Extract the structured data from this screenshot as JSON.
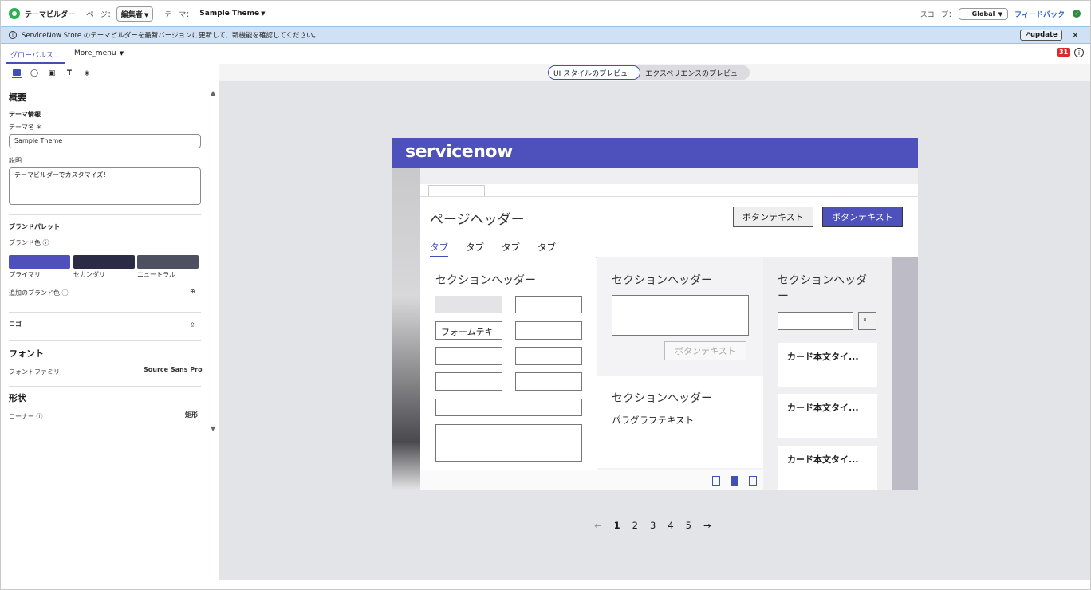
{
  "topbar": {
    "app_title": "テーマビルダー",
    "page_label": "ページ：",
    "page_value": "編集者",
    "theme_label": "テーマ：",
    "theme_value": "Sample Theme",
    "scope_label": "スコープ：",
    "scope_value": "Global",
    "feedback": "フィードバック"
  },
  "banner": {
    "text": "ServiceNow Store のテーマビルダーを最新バージョンに更新して、新機能を確認してください。",
    "update": "update"
  },
  "tabs": {
    "global": "グローバルス...",
    "more": "More_menu",
    "badge": "31"
  },
  "left": {
    "overview": "概要",
    "theme_info": "テーマ情報",
    "theme_name_label": "テーマ名 ✳",
    "theme_name_value": "Sample Theme",
    "desc_label": "説明",
    "desc_value": "テーマビルダーでカスタマイズ！",
    "brand_palette": "ブランドパレット",
    "brand_color": "ブランド色",
    "swatches": [
      {
        "label": "プライマリ",
        "color": "#4e51bc"
      },
      {
        "label": "セカンダリ",
        "color": "#2c2b45"
      },
      {
        "label": "ニュートラル",
        "color": "#4d5060"
      }
    ],
    "add_brand_color": "追加のブランド色",
    "logo": "ロゴ",
    "font": "フォント",
    "font_family_label": "フォントファミリ",
    "font_family_value": "Source Sans Pro",
    "shape": "形状",
    "corner_label": "コーナー",
    "corner_value": "矩形"
  },
  "preview_toggle": {
    "ui_style": "UI スタイルのプレビュー",
    "experience": "エクスペリエンスのプレビュー"
  },
  "preview": {
    "logo": "servicenow",
    "page_header": "ページヘッダー",
    "button_text": "ボタンテキスト",
    "tabs": [
      "タブ",
      "タブ",
      "タブ",
      "タブ"
    ],
    "section_header": "セクションヘッダー",
    "section_header_wrap": "セクションヘッダ\nー",
    "form_text": "フォームテキ",
    "paragraph": "パラグラフテキスト",
    "card_text": "カード本文タイ..."
  },
  "pager": {
    "prev": "←",
    "pages": [
      "1",
      "2",
      "3",
      "4",
      "5"
    ],
    "next": "→"
  }
}
